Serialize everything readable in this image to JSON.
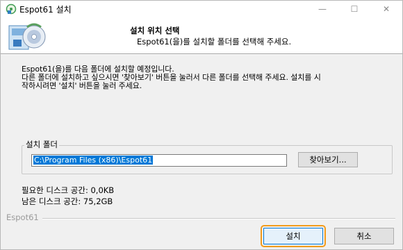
{
  "window": {
    "title": "Espot61 설치",
    "minimize_glyph": "—",
    "maximize_glyph": "☐",
    "close_glyph": "✕"
  },
  "header": {
    "title": "설치 위치 선택",
    "subtitle": "Espot61(을)를 설치할 폴더를 선택해 주세요."
  },
  "intro": {
    "lines": [
      "Espot61(을)를 다음 폴더에 설치할 예정입니다.",
      "다른 폴더에 설치하고 싶으시면 '찾아보기' 버튼을 눌러서 다른 폴더를 선택해 주세요. 설치를 시",
      "작하시려면 '설치' 버튼을 눌러 주세요."
    ]
  },
  "folder_group": {
    "legend": "설치 폴더",
    "path_value": "C:\\Program Files (x86)\\Espot61",
    "browse_label": "찾아보기..."
  },
  "space": {
    "required": "필요한 디스크 공간: 0,0KB",
    "available": "남은 디스크 공간: 75,2GB"
  },
  "footer": {
    "brand": "Espot61",
    "install_label": "설치",
    "cancel_label": "취소"
  },
  "colors": {
    "selection": "#0078d7",
    "focus_outline": "#f29b1b",
    "window_bg": "#f0f0f0"
  }
}
